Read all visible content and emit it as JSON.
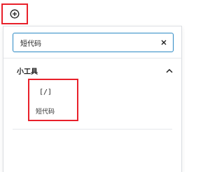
{
  "toolbar": {
    "add_button_icon": "plus-circle-icon"
  },
  "inserter": {
    "search": {
      "value": "短代码",
      "clear_icon": "close-icon"
    },
    "panel": {
      "title": "小工具",
      "toggle_icon": "chevron-up-icon",
      "items": [
        {
          "icon_text": "[/]",
          "label": "短代码"
        }
      ]
    }
  },
  "colors": {
    "highlight": "#e8202a",
    "focus_border": "#2b89c4"
  }
}
